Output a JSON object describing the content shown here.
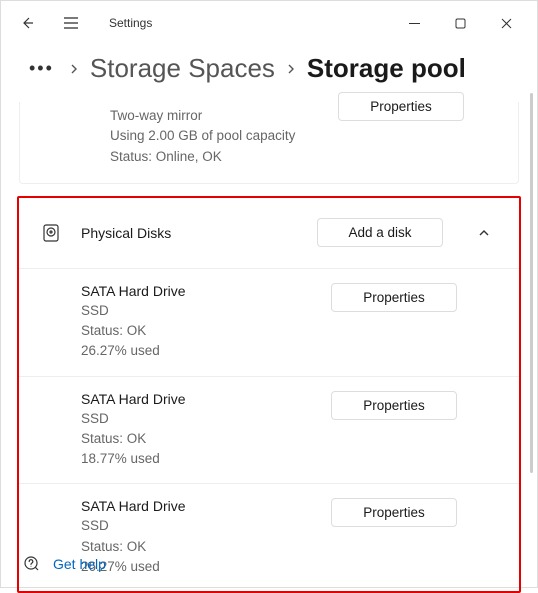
{
  "titlebar": {
    "app_title": "Settings"
  },
  "breadcrumb": {
    "prev": "Storage Spaces",
    "current": "Storage pool"
  },
  "top_fragment": {
    "line1": "Two-way mirror",
    "line2": "Using 2.00 GB of pool capacity",
    "line3": "Status: Online, OK",
    "button": "Properties"
  },
  "section": {
    "title": "Physical Disks",
    "add_button": "Add a disk",
    "disks": [
      {
        "name": "SATA Hard Drive",
        "type": "SSD",
        "status": "Status: OK",
        "used": "26.27% used",
        "button": "Properties"
      },
      {
        "name": "SATA Hard Drive",
        "type": "SSD",
        "status": "Status: OK",
        "used": "18.77% used",
        "button": "Properties"
      },
      {
        "name": "SATA Hard Drive",
        "type": "SSD",
        "status": "Status: OK",
        "used": "26.27% used",
        "button": "Properties"
      }
    ]
  },
  "footer": {
    "help": "Get help"
  }
}
